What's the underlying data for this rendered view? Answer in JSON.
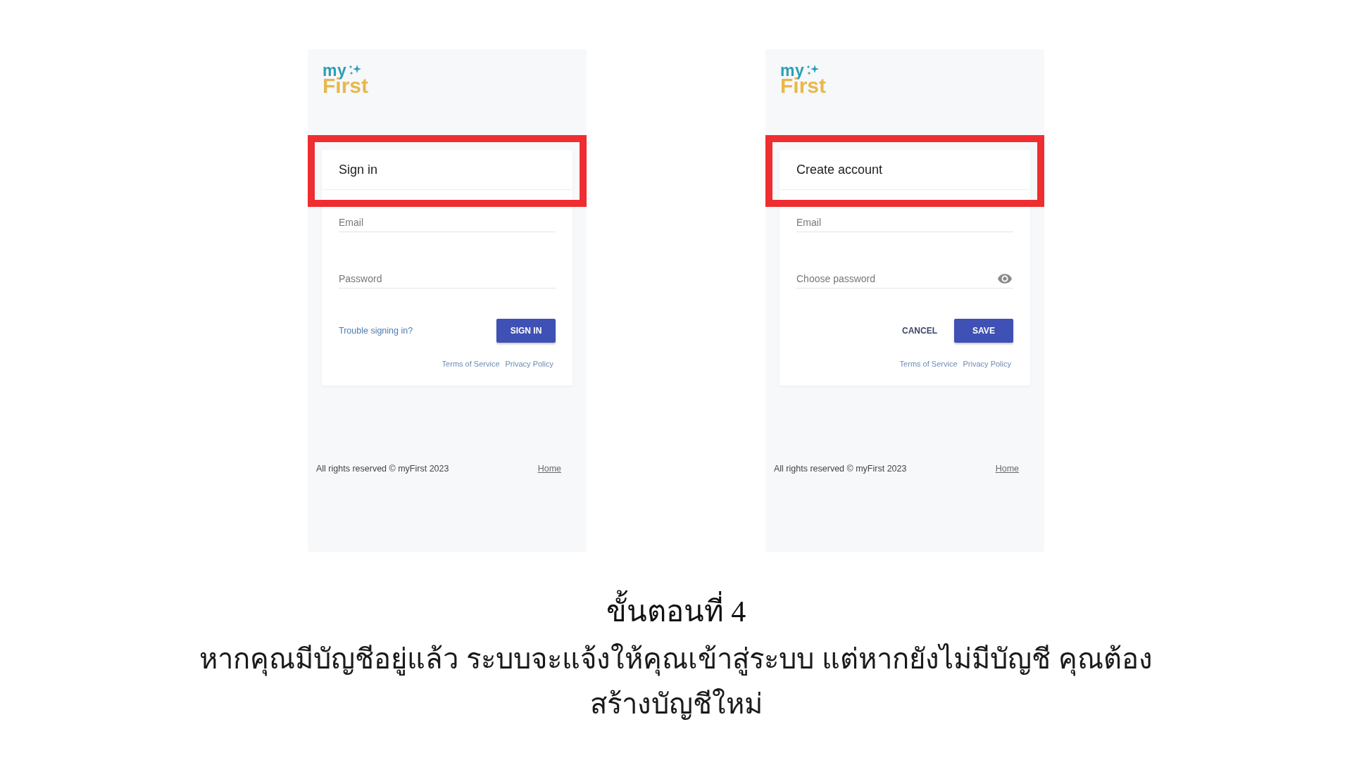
{
  "screens": [
    {
      "logo": {
        "top": "my",
        "bottom": "First"
      },
      "header": {
        "title": "Sign in",
        "highlighted": true
      },
      "fields": [
        {
          "placeholder": "Email",
          "kind": "plain"
        },
        {
          "placeholder": "Password",
          "kind": "plain"
        }
      ],
      "actions": [
        {
          "label": "Trouble signing in?",
          "kind": "link"
        },
        {
          "label": "SIGN IN",
          "kind": "primary"
        }
      ],
      "legal_links": [
        "Terms of Service",
        "Privacy Policy"
      ],
      "footer": {
        "copyright": "All rights reserved © myFirst 2023",
        "home_link": "Home"
      }
    },
    {
      "logo": {
        "top": "my",
        "bottom": "First"
      },
      "header": {
        "title": "Create account",
        "highlighted": true
      },
      "fields": [
        {
          "placeholder": "Email",
          "kind": "plain"
        },
        {
          "placeholder": "Choose password",
          "kind": "reveal"
        }
      ],
      "actions": [
        {
          "label": "CANCEL",
          "kind": "text"
        },
        {
          "label": "SAVE",
          "kind": "primary"
        }
      ],
      "legal_links": [
        "Terms of Service",
        "Privacy Policy"
      ],
      "footer": {
        "copyright": "All rights reserved © myFirst 2023",
        "home_link": "Home"
      }
    }
  ],
  "caption": {
    "title": "ขั้นตอนที่ 4",
    "text": "หากคุณมีบัญชีอยู่แล้ว ระบบจะแจ้งให้คุณเข้าสู่ระบบ แต่หากยังไม่มีบัญชี คุณต้องสร้างบัญชีใหม่"
  }
}
